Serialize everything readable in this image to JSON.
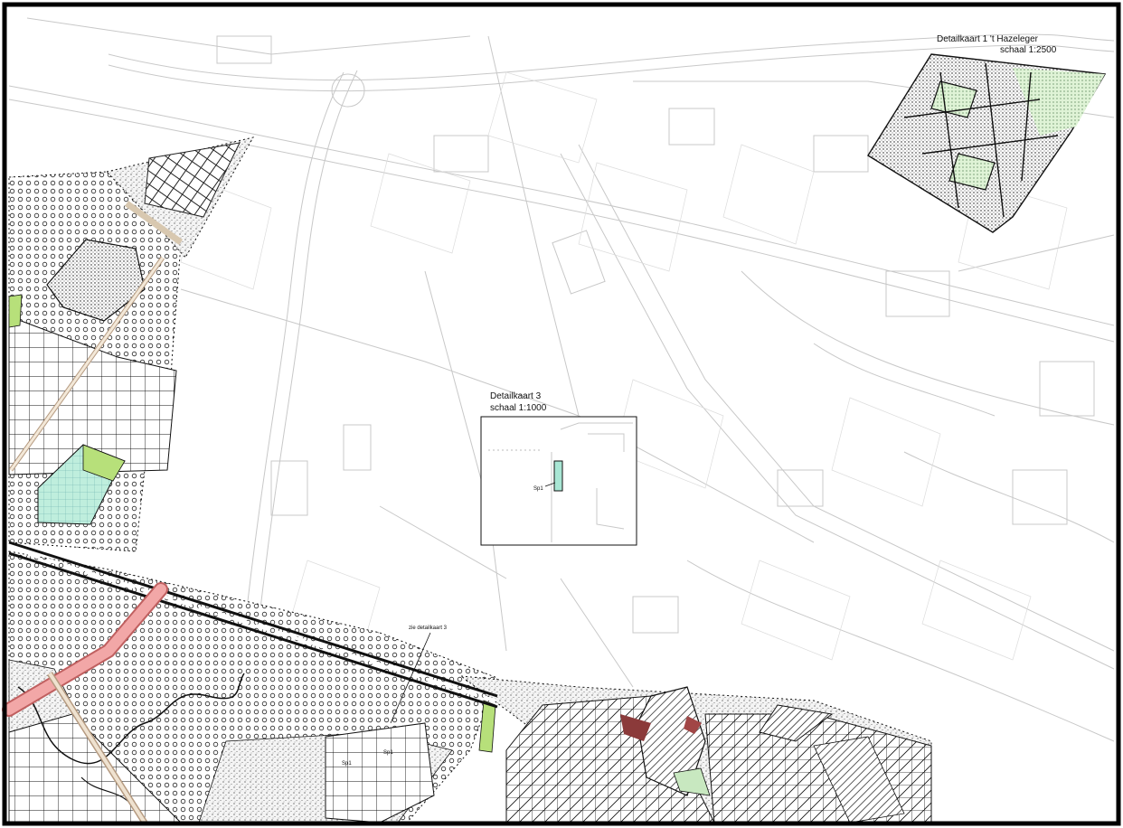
{
  "inset_1": {
    "title": "Detailkaart 1 't Hazeleger",
    "scale": "schaal 1:2500"
  },
  "inset_3": {
    "title": "Detailkaart 3",
    "scale": "schaal 1:1000",
    "marker_label": "Sp1"
  },
  "annotations": {
    "see_detail": "zie detailkaart 3",
    "zone_label_a": "Sp1",
    "zone_label_b": "Sp1"
  },
  "colors": {
    "frame": "#000000",
    "base_lines": "#c8c8c8",
    "green_area": "#b7e07a",
    "teal_area": "#bfeedd",
    "road_pink": "#f2a7a7",
    "brown_area": "#8b3a3a",
    "hatch": "#111111"
  }
}
